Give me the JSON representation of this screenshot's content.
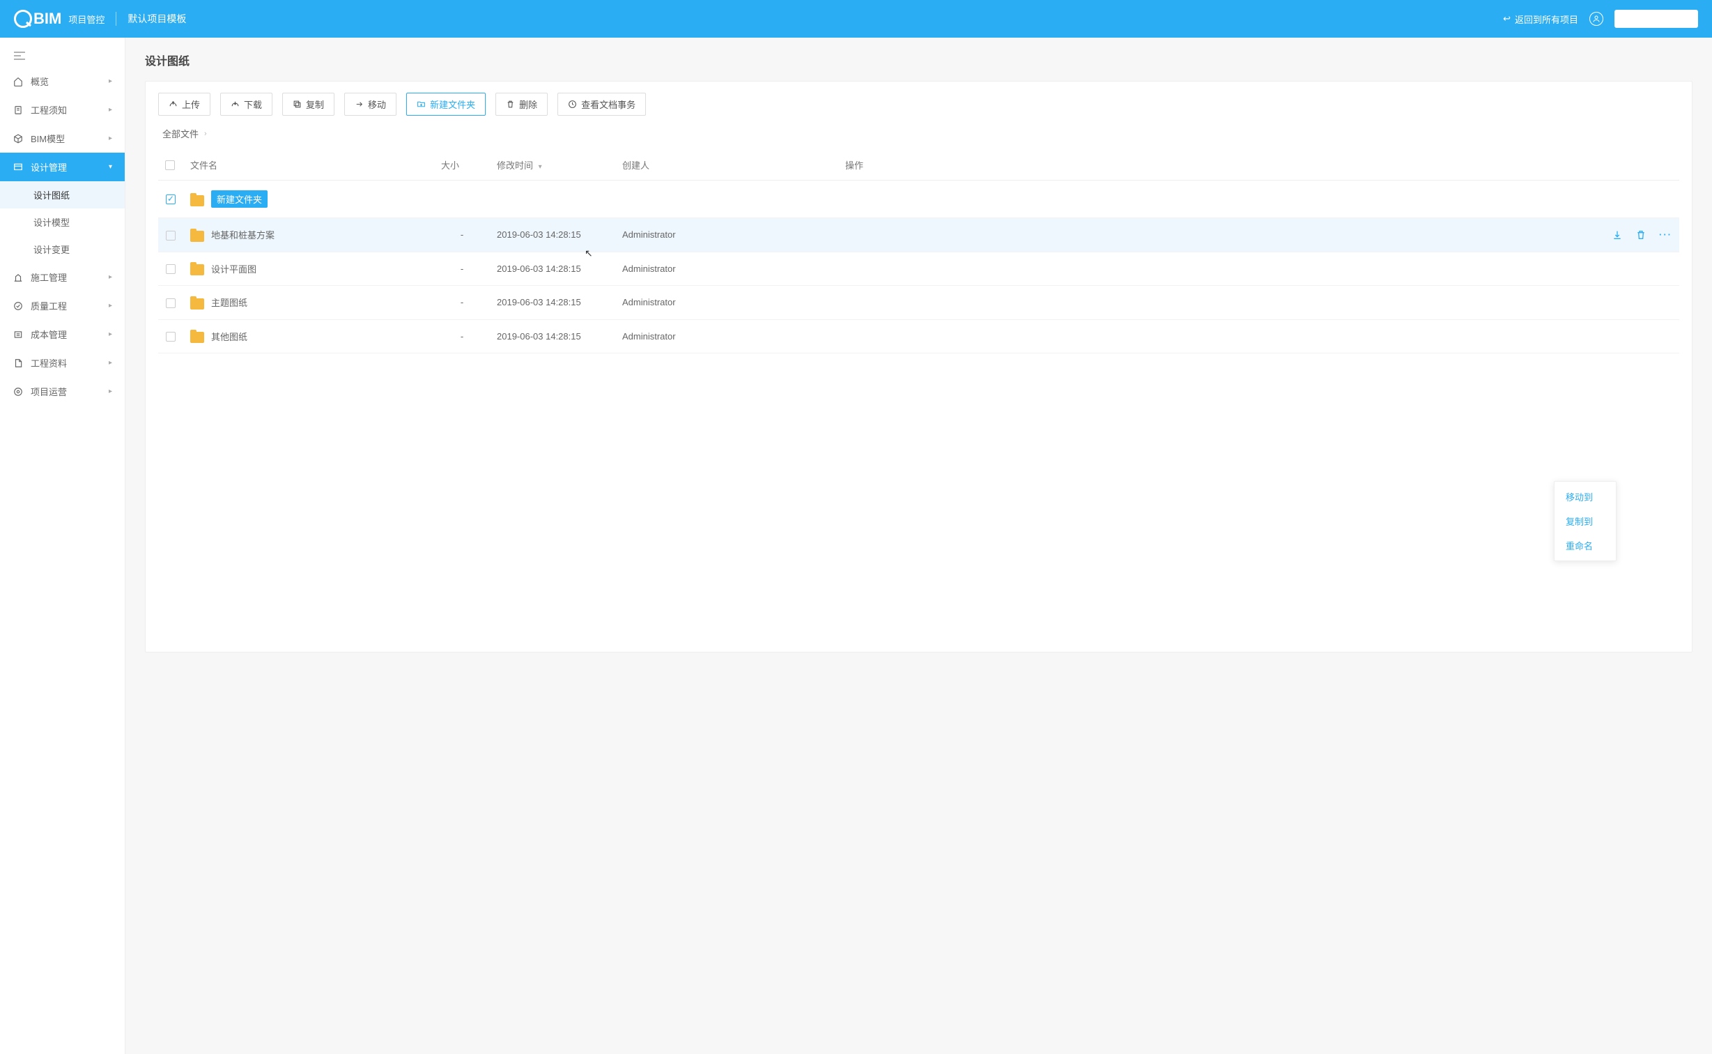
{
  "header": {
    "logo_text": "BIM",
    "logo_sub": "项目管控",
    "project_title": "默认项目模板",
    "back_link": "返回到所有项目"
  },
  "sidebar": {
    "items": [
      {
        "icon": "home",
        "label": "概览",
        "expand": true
      },
      {
        "icon": "doc",
        "label": "工程须知",
        "expand": true
      },
      {
        "icon": "cube",
        "label": "BIM模型",
        "expand": true
      },
      {
        "icon": "design",
        "label": "设计管理",
        "expand": true,
        "active": true,
        "children": [
          {
            "label": "设计图纸",
            "active": true
          },
          {
            "label": "设计模型"
          },
          {
            "label": "设计变更"
          }
        ]
      },
      {
        "icon": "construct",
        "label": "施工管理",
        "expand": true
      },
      {
        "icon": "quality",
        "label": "质量工程",
        "expand": true
      },
      {
        "icon": "cost",
        "label": "成本管理",
        "expand": true
      },
      {
        "icon": "data",
        "label": "工程资料",
        "expand": true
      },
      {
        "icon": "ops",
        "label": "项目运营",
        "expand": true
      }
    ]
  },
  "page": {
    "title": "设计图纸",
    "toolbar": [
      {
        "icon": "upload",
        "label": "上传"
      },
      {
        "icon": "download",
        "label": "下载"
      },
      {
        "icon": "copy",
        "label": "复制"
      },
      {
        "icon": "move",
        "label": "移动"
      },
      {
        "icon": "newfolder",
        "label": "新建文件夹",
        "active": true
      },
      {
        "icon": "delete",
        "label": "删除"
      },
      {
        "icon": "history",
        "label": "查看文档事务"
      }
    ],
    "breadcrumb": {
      "root": "全部文件"
    },
    "table": {
      "headers": {
        "name": "文件名",
        "size": "大小",
        "modified": "修改时间",
        "creator": "创建人",
        "ops": "操作"
      },
      "rows": [
        {
          "checked": true,
          "editing": true,
          "name": "新建文件夹",
          "size": "",
          "modified": "",
          "creator": ""
        },
        {
          "checked": false,
          "name": "地基和桩基方案",
          "size": "-",
          "modified": "2019-06-03 14:28:15",
          "creator": "Administrator",
          "hover": true
        },
        {
          "checked": false,
          "name": "设计平面图",
          "size": "-",
          "modified": "2019-06-03 14:28:15",
          "creator": "Administrator"
        },
        {
          "checked": false,
          "name": "主题图纸",
          "size": "-",
          "modified": "2019-06-03 14:28:15",
          "creator": "Administrator"
        },
        {
          "checked": false,
          "name": "其他图纸",
          "size": "-",
          "modified": "2019-06-03 14:28:15",
          "creator": "Administrator"
        }
      ]
    },
    "context_menu": [
      "移动到",
      "复制到",
      "重命名"
    ]
  }
}
